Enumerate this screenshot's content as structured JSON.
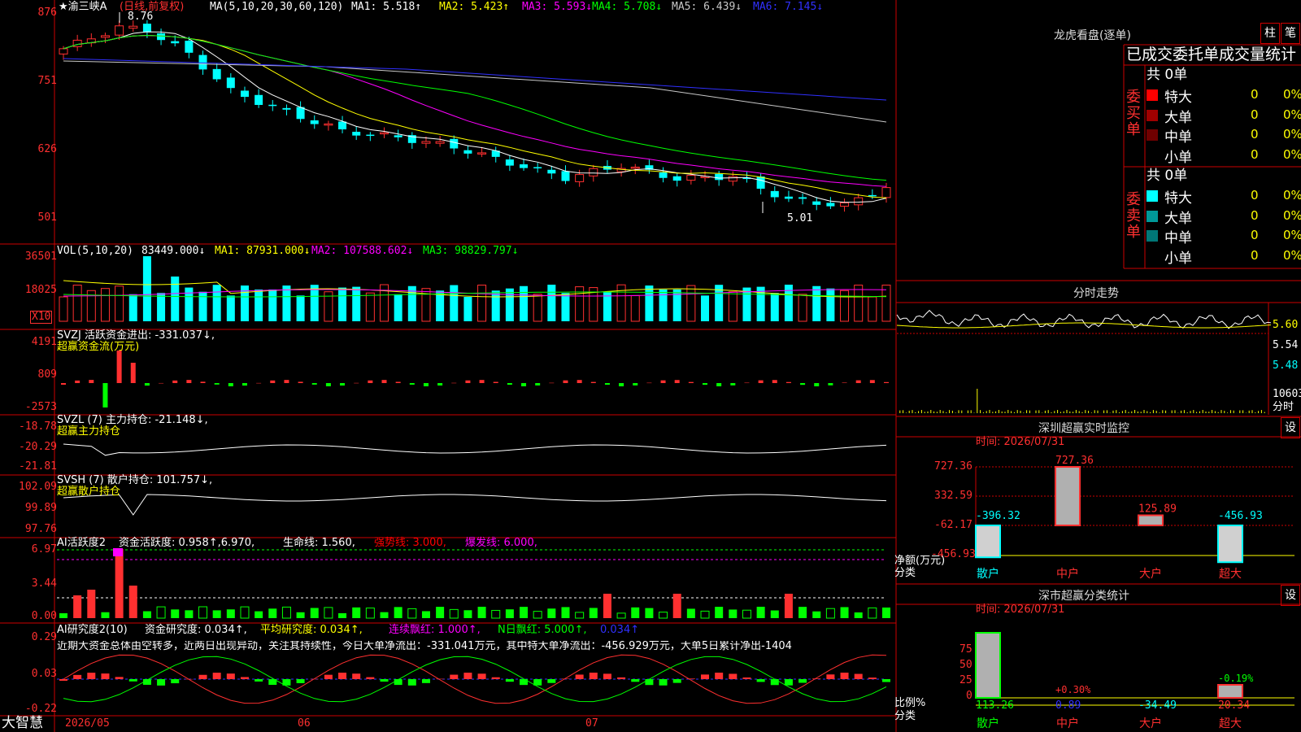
{
  "main": {
    "stock_name": "★渝三峡A",
    "period": "(日线,前复权)",
    "ma_prefix": "MA(5,10,20,30,60,120)",
    "ma_items": [
      {
        "label": "MA1: 5.518↑",
        "color": "#ffffff"
      },
      {
        "label": "MA2: 5.423↑",
        "color": "#ffff00"
      },
      {
        "label": "MA3: 5.593↓",
        "color": "#ff00ff"
      },
      {
        "label": "MA4: 5.708↓",
        "color": "#00ff00"
      },
      {
        "label": "MA5: 6.439↓",
        "color": "#c8c8c8"
      },
      {
        "label": "MA6: 7.145↓",
        "color": "#3030ff"
      }
    ],
    "high_label": "8.76",
    "low_label": "5.01",
    "y_ticks": [
      "876",
      "751",
      "626",
      "501"
    ]
  },
  "vol": {
    "label": "VOL(5,10,20)",
    "value": "83449.000↓",
    "ma1": "MA1: 87931.000↓",
    "ma2": "MA2: 107588.602↓",
    "ma3": "MA3: 98829.797↓",
    "y_ticks": [
      "36501",
      "18025"
    ],
    "unit": "X10"
  },
  "svzj": {
    "label": "SVZJ  活跃资金进出: -331.037↓,",
    "subtitle": "超赢资金流(万元)",
    "y_ticks": [
      "4191",
      "809",
      "-2573"
    ]
  },
  "svzl": {
    "label": "SVZL (7) 主力持仓: -21.148↓,",
    "subtitle": "超赢主力持仓",
    "y_ticks": [
      "-18.78",
      "-20.29",
      "-21.81"
    ]
  },
  "svsh": {
    "label": "SVSH (7) 散户持仓: 101.757↓,",
    "subtitle": "超赢散户持仓",
    "y_ticks": [
      "102.09",
      "99.89",
      "97.76"
    ]
  },
  "ai_active": {
    "label": "AI活跃度2",
    "item1": "资金活跃度: 0.958↑,6.970,",
    "item2": "生命线: 1.560,",
    "item3": "强势线: 3.000,",
    "item4": "爆发线: 6.000,",
    "y_ticks": [
      "6.97",
      "3.44",
      "0.00"
    ]
  },
  "ai_research": {
    "label": "AI研究度2(10)",
    "item1": "资金研究度: 0.034↑,",
    "item2": "平均研究度: 0.034↑,",
    "item3": "连续飘红: 1.000↑,",
    "item4": "N日飘红: 5.000↑,",
    "item5": "0.034↑",
    "commentary": "近期大资金总体由空转多，近两日出现异动，关注其持续性，今日大单净流出：-331.041万元，其中特大单净流出：-456.929万元，大单5日累计净出-1404",
    "y_ticks": [
      "0.29",
      "0.03",
      "-0.22"
    ]
  },
  "xaxis": {
    "brand": "大智慧",
    "labels": [
      "2026/05",
      "06",
      "07"
    ]
  },
  "right": {
    "dragon_title": "龙虎看盘(逐单)",
    "btn1": "柱",
    "btn2": "笔",
    "order_stats_title": "已成交委托单成交量统计",
    "buy_side": {
      "label": "委买单",
      "total": "共 0单",
      "rows": [
        {
          "name": "特大",
          "count": "0",
          "pct": "0%",
          "color": "#ff0000"
        },
        {
          "name": "大单",
          "count": "0",
          "pct": "0%",
          "color": "#a00000"
        },
        {
          "name": "中单",
          "count": "0",
          "pct": "0%",
          "color": "#700000"
        },
        {
          "name": "小单",
          "count": "0",
          "pct": "0%",
          "color": "#000000"
        }
      ]
    },
    "sell_side": {
      "label": "委卖单",
      "total": "共 0单",
      "rows": [
        {
          "name": "特大",
          "count": "0",
          "pct": "0%",
          "color": "#00ffff"
        },
        {
          "name": "大单",
          "count": "0",
          "pct": "0%",
          "color": "#009999"
        },
        {
          "name": "中单",
          "count": "0",
          "pct": "0%",
          "color": "#007777"
        },
        {
          "name": "小单",
          "count": "0",
          "pct": "0%",
          "color": "#000000"
        }
      ]
    },
    "intraday": {
      "title": "分时走势",
      "prices": [
        "5.60",
        "5.54",
        "5.48"
      ],
      "volume": "10603",
      "unit": "分时"
    },
    "monitor": {
      "title": "深圳超赢实时监控",
      "btn": "设",
      "time": "时间: 2026/07/31",
      "y_ticks": [
        "727.36",
        "332.59",
        "-62.17",
        "-456.93"
      ],
      "y_unit": "净额(万元)",
      "x_unit": "分类",
      "categories": [
        "散户",
        "中户",
        "大户",
        "超大"
      ],
      "values": [
        -396.32,
        727.36,
        125.89,
        -456.93
      ],
      "value_labels": [
        "-396.32",
        "727.36",
        "125.89",
        "-456.93"
      ]
    },
    "classify": {
      "title": "深市超赢分类统计",
      "btn": "设",
      "time": "时间: 2026/07/31",
      "y_ticks": [
        "75",
        "50",
        "25",
        "0"
      ],
      "y_unit": "比例%",
      "x_unit": "分类",
      "categories": [
        "散户",
        "中户",
        "大户",
        "超大"
      ],
      "values": [
        113.26,
        0.89,
        -34.49,
        20.34
      ],
      "value_labels": [
        "113.26",
        "0.89",
        "-34.49",
        "20.34"
      ],
      "pct_labels": [
        "",
        "+0.30%",
        "",
        "-0.19%"
      ]
    }
  }
}
